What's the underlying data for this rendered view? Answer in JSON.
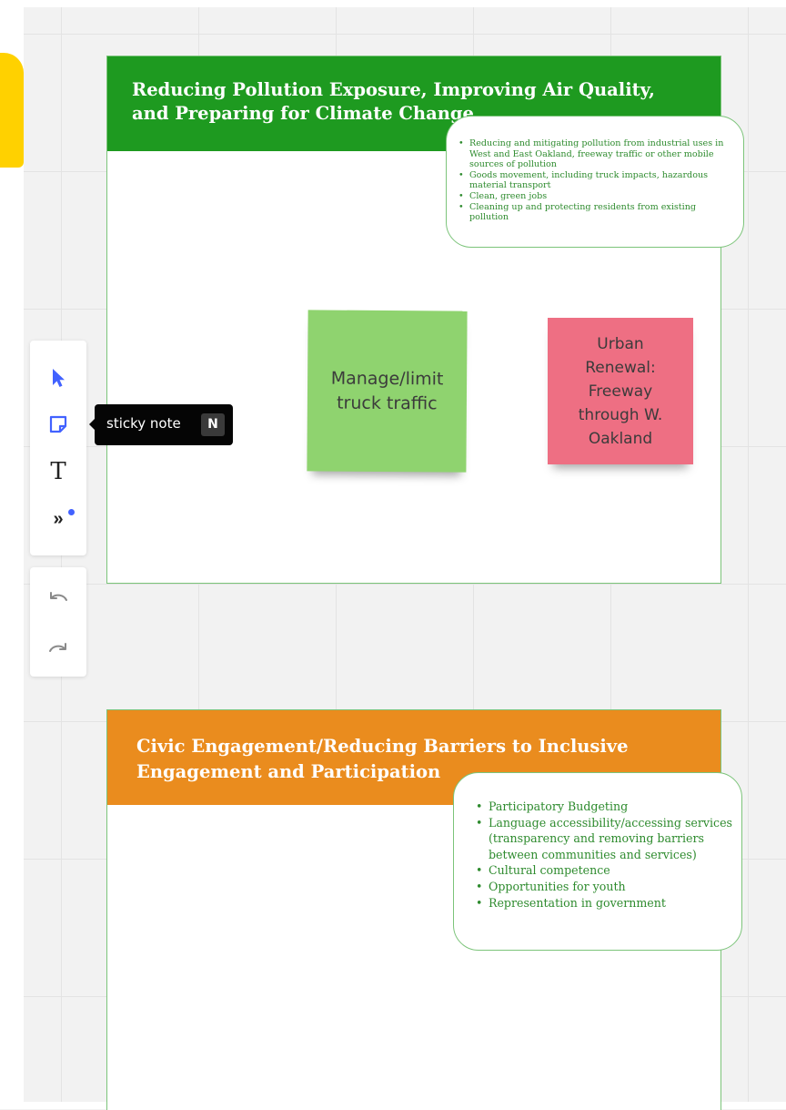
{
  "board": {
    "frames": [
      {
        "title": "Reducing Pollution Exposure, Improving Air Quality, and Preparing for Climate Change",
        "header_color": "#1e9a20",
        "bullets": [
          "Reducing and mitigating pollution from industrial uses in West and East Oakland, freeway traffic or other mobile sources of pollution",
          "Goods movement, including truck impacts, hazardous material transport",
          "Clean, green jobs",
          "Cleaning up and protecting residents from existing pollution"
        ],
        "sticky_notes": [
          {
            "text": "Manage/limit truck traffic",
            "color": "#8fd36f"
          },
          {
            "text": "Urban Renewal: Freeway through W. Oakland",
            "color": "#ee6f83"
          }
        ]
      },
      {
        "title": "Civic Engagement/Reducing Barriers to Inclusive Engagement and Participation",
        "header_color": "#ea8c1e",
        "bullets": [
          "Participatory Budgeting",
          "Language accessibility/accessing services (transparency and removing barriers between communities and services)",
          "Cultural competence",
          "Opportunities for youth",
          "Representation in government"
        ]
      }
    ]
  },
  "toolbar": {
    "tools": [
      {
        "name": "select",
        "icon": "cursor-icon"
      },
      {
        "name": "sticky note",
        "icon": "sticky-note-icon"
      },
      {
        "name": "text",
        "icon": "text-icon"
      },
      {
        "name": "more",
        "icon": "chevrons-right-icon"
      }
    ],
    "history": [
      {
        "name": "undo",
        "icon": "undo-icon"
      },
      {
        "name": "redo",
        "icon": "redo-icon"
      }
    ],
    "accent_color": "#4262ff"
  },
  "tooltip": {
    "label": "sticky note",
    "shortcut": "N"
  }
}
